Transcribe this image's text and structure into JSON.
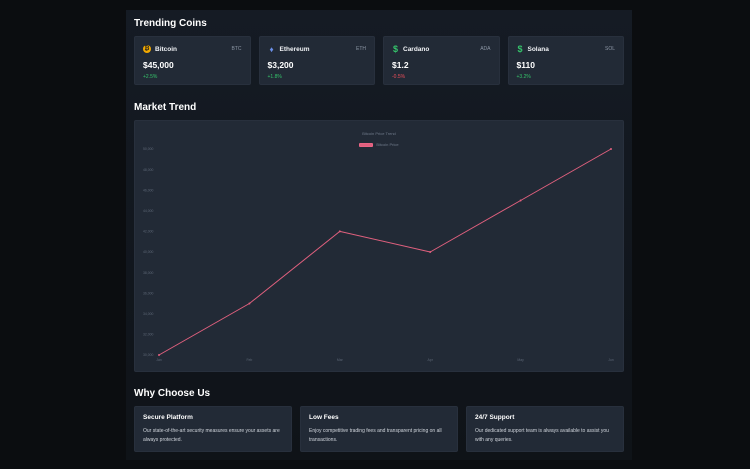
{
  "trending": {
    "title": "Trending Coins",
    "coins": [
      {
        "name": "Bitcoin",
        "symbol": "BTC",
        "price": "$45,000",
        "change": "+2.5%",
        "direction": "up",
        "icon": "bitcoin-icon"
      },
      {
        "name": "Ethereum",
        "symbol": "ETH",
        "price": "$3,200",
        "change": "+1.8%",
        "direction": "up",
        "icon": "ethereum-icon"
      },
      {
        "name": "Cardano",
        "symbol": "ADA",
        "price": "$1.2",
        "change": "-0.5%",
        "direction": "down",
        "icon": "dollar-icon"
      },
      {
        "name": "Solana",
        "symbol": "SOL",
        "price": "$110",
        "change": "+3.2%",
        "direction": "up",
        "icon": "dollar-icon"
      }
    ]
  },
  "market": {
    "title": "Market Trend"
  },
  "chart_data": {
    "type": "line",
    "title": "Bitcoin Price Trend",
    "categories": [
      "Jan",
      "Feb",
      "Mar",
      "Apr",
      "May",
      "Jun"
    ],
    "series": [
      {
        "name": "Bitcoin Price",
        "values": [
          30000,
          35000,
          42000,
          40000,
          45000,
          50000
        ],
        "color": "#e0607e"
      }
    ],
    "yticks": [
      "30,000",
      "32,000",
      "34,000",
      "36,000",
      "38,000",
      "40,000",
      "42,000",
      "44,000",
      "46,000",
      "48,000",
      "50,000"
    ],
    "ylim": [
      30000,
      50000
    ],
    "grid": false,
    "legend": "top-center"
  },
  "why": {
    "title": "Why Choose Us",
    "cards": [
      {
        "title": "Secure Platform",
        "text": "Our state-of-the-art security measures ensure your assets are always protected."
      },
      {
        "title": "Low Fees",
        "text": "Enjoy competitive trading fees and transparent pricing on all transactions."
      },
      {
        "title": "24/7 Support",
        "text": "Our dedicated support team is always available to assist you with any queries."
      }
    ]
  },
  "colors": {
    "background": "#0b0d10",
    "card": "#222a36",
    "positive": "#35c46b",
    "negative": "#ef4f5a",
    "line": "#e0607e"
  }
}
